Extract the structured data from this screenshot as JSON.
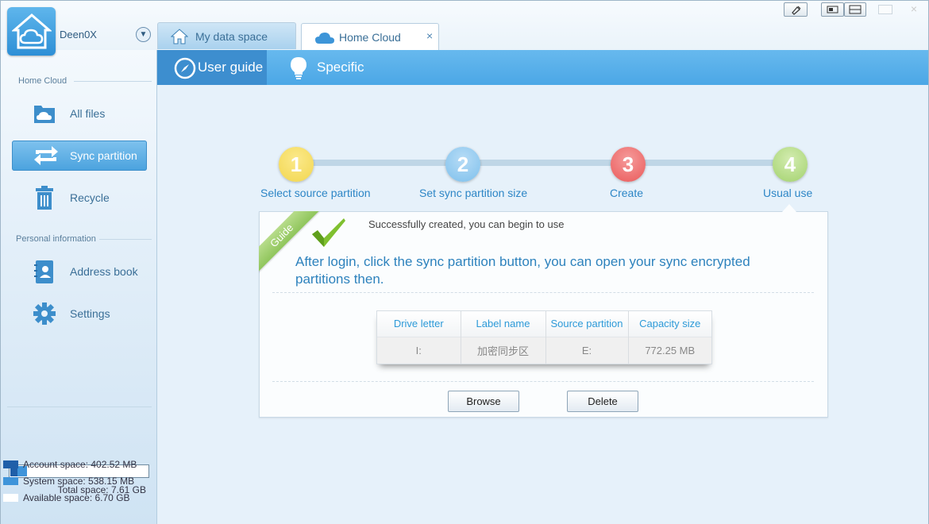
{
  "account": {
    "username": "Deen0X"
  },
  "tabs": [
    {
      "label": "My data space",
      "icon": "home-icon"
    },
    {
      "label": "Home Cloud",
      "icon": "cloud-icon",
      "close": "×"
    }
  ],
  "header": {
    "items": [
      {
        "label": "User guide",
        "icon": "compass-icon"
      },
      {
        "label": "Specific",
        "icon": "lightbulb-icon"
      }
    ]
  },
  "sidebar": {
    "section1": "Home Cloud",
    "section2": "Personal information",
    "items": [
      {
        "label": "All files",
        "icon": "folder-cloud-icon"
      },
      {
        "label": "Sync partition",
        "icon": "sync-icon"
      },
      {
        "label": "Recycle",
        "icon": "trash-icon"
      },
      {
        "label": "Address book",
        "icon": "address-book-icon"
      },
      {
        "label": "Settings",
        "icon": "gear-icon"
      }
    ],
    "storage": {
      "total": "Total space: 7.61 GB",
      "account": "Account space: 402.52 MB",
      "system": "System space: 538.15 MB",
      "available": "Available space: 6.70 GB",
      "account_fraction": 0.052,
      "system_fraction": 0.071
    }
  },
  "steps": [
    {
      "num": "1",
      "label": "Select source partition",
      "color": "#f2d64f"
    },
    {
      "num": "2",
      "label": "Set sync partition size",
      "color": "#7ec0ec"
    },
    {
      "num": "3",
      "label": "Create",
      "color": "#ea5a5a"
    },
    {
      "num": "4",
      "label": "Usual use",
      "color": "#a3d26e"
    }
  ],
  "panel": {
    "ribbon": "Guide",
    "success": "Successfully created, you can begin to use",
    "message": "After login, click the sync partition button, you can open your sync encrypted partitions then.",
    "table": {
      "headers": [
        "Drive letter",
        "Label name",
        "Source partition",
        "Capacity size"
      ],
      "row": [
        "I:",
        "加密同步区",
        "E:",
        "772.25 MB"
      ]
    },
    "buttons": {
      "browse": "Browse",
      "delete": "Delete"
    }
  },
  "colors": {
    "accent": "#4ba7e6",
    "link": "#2d86c6"
  }
}
